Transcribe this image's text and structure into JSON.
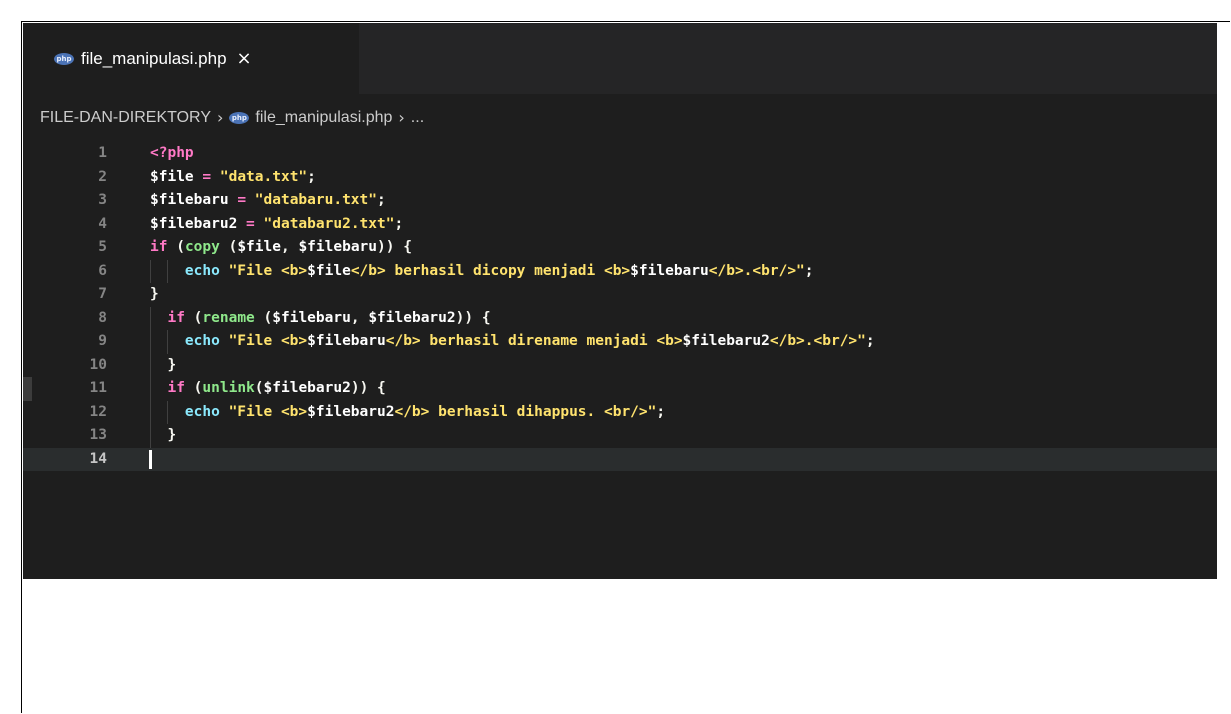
{
  "tab": {
    "icon": "php-file-icon",
    "title": "file_manipulasi.php",
    "close": "×"
  },
  "breadcrumb": {
    "folder": "FILE-DAN-DIREKTORY",
    "file": "file_manipulasi.php",
    "more": "...",
    "separator": "›"
  },
  "php_icon_text": "php",
  "colors": {
    "editor_bg": "#1e1e1e",
    "tabbar_bg": "#252526",
    "keyword": "#ff79c6",
    "string": "#ffe36e",
    "function": "#8fe88b",
    "line_number": "#858585"
  },
  "lines": [
    {
      "n": "1",
      "text": "<?php"
    },
    {
      "n": "2",
      "text": "$file = \"data.txt\";"
    },
    {
      "n": "3",
      "text": "$filebaru = \"databaru.txt\";"
    },
    {
      "n": "4",
      "text": "$filebaru2 = \"databaru2.txt\";"
    },
    {
      "n": "5",
      "text": "if (copy ($file, $filebaru)) {"
    },
    {
      "n": "6",
      "text": "    echo \"File <b>$file</b> berhasil dicopy menjadi <b>$filebaru</b>.<br/>\";"
    },
    {
      "n": "7",
      "text": "}"
    },
    {
      "n": "8",
      "text": "  if (rename ($filebaru, $filebaru2)) {"
    },
    {
      "n": "9",
      "text": "    echo \"File <b>$filebaru</b> berhasil direname menjadi <b>$filebaru2</b>.<br/>\";"
    },
    {
      "n": "10",
      "text": "  }"
    },
    {
      "n": "11",
      "text": "  if (unlink($filebaru2)) {"
    },
    {
      "n": "12",
      "text": "    echo \"File <b>$filebaru2</b> berhasil dihappus. <br/>\";"
    },
    {
      "n": "13",
      "text": "  }"
    },
    {
      "n": "14",
      "text": ""
    }
  ]
}
